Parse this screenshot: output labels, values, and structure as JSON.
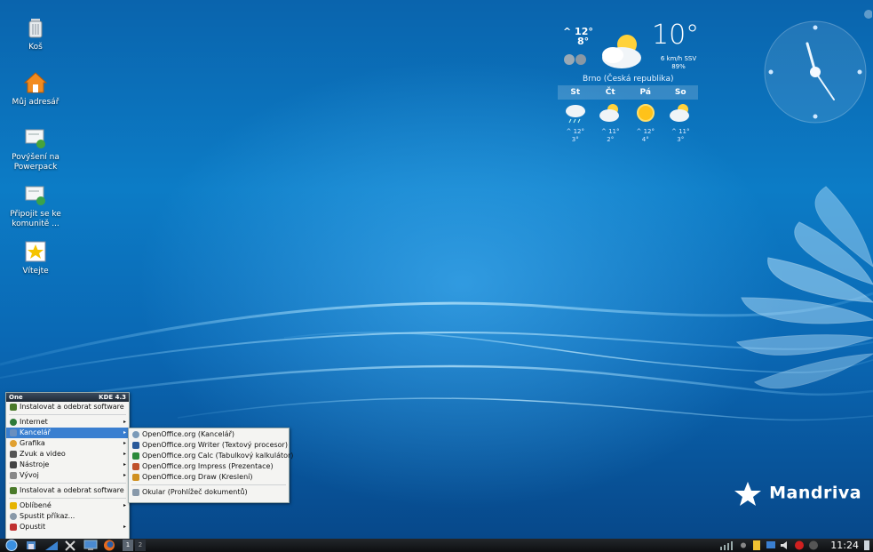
{
  "desktop_icons": [
    {
      "label": "Koš",
      "icon": "trash-icon"
    },
    {
      "label": "Můj adresář",
      "icon": "home-folder-icon"
    },
    {
      "label": "Povýšení na Powerpack",
      "icon": "upgrade-icon"
    },
    {
      "label": "Připojit se ke komunitě ...",
      "icon": "community-icon"
    },
    {
      "label": "Vítejte",
      "icon": "welcome-icon"
    }
  ],
  "weather": {
    "hi_lo_high": "^ 12°",
    "hi_lo_low": "8°",
    "current_temp": "10°",
    "wind": "6 km/h SSV",
    "humidity": "89%",
    "location": "Brno (Česká republika)",
    "days": [
      {
        "name": "St",
        "high": "^ 12°",
        "low": "3°",
        "icon": "cloud-rain-icon"
      },
      {
        "name": "Čt",
        "high": "^ 11°",
        "low": "2°",
        "icon": "partly-cloudy-icon"
      },
      {
        "name": "Pá",
        "high": "^ 12°",
        "low": "4°",
        "icon": "sun-icon"
      },
      {
        "name": "So",
        "high": "^ 11°",
        "low": "3°",
        "icon": "partly-cloudy-icon"
      }
    ]
  },
  "brand": {
    "name": "Mandriva"
  },
  "menu": {
    "header_left": "One",
    "header_right": "KDE 4.3",
    "items": [
      {
        "label": "Instalovat a odebrat software",
        "icon": "install-icon",
        "color": "#4a7a2a",
        "submenu": false
      },
      {
        "label": "Internet",
        "icon": "globe-icon",
        "color": "#2d7a3a",
        "submenu": true
      },
      {
        "label": "Kancelář",
        "icon": "office-icon",
        "color": "#6a8fbf",
        "submenu": true
      },
      {
        "label": "Grafika",
        "icon": "graphics-icon",
        "color": "#e0a030",
        "submenu": true
      },
      {
        "label": "Zvuk a video",
        "icon": "media-icon",
        "color": "#555555",
        "submenu": true
      },
      {
        "label": "Nástroje",
        "icon": "tools-icon",
        "color": "#444444",
        "submenu": true
      },
      {
        "label": "Vývoj",
        "icon": "devel-icon",
        "color": "#888888",
        "submenu": true
      },
      {
        "label": "Instalovat a odebrat software",
        "icon": "install-icon",
        "color": "#4a7a2a",
        "submenu": false
      },
      {
        "label": "Oblíbené",
        "icon": "favorites-icon",
        "color": "#e6b400",
        "submenu": true
      },
      {
        "label": "Spustit příkaz...",
        "icon": "run-icon",
        "color": "#8898a8",
        "submenu": false
      },
      {
        "label": "Opustit",
        "icon": "quit-icon",
        "color": "#c03030",
        "submenu": true
      }
    ],
    "selected_index": 2
  },
  "submenu": {
    "items": [
      {
        "label": "OpenOffice.org (Kancelář)",
        "icon": "openoffice-icon",
        "color": "#7a9ab8"
      },
      {
        "label": "OpenOffice.org Writer (Textový procesor)",
        "icon": "writer-icon",
        "color": "#2a5a9a"
      },
      {
        "label": "OpenOffice.org Calc (Tabulkový kalkulátor)",
        "icon": "calc-icon",
        "color": "#2a8a3a"
      },
      {
        "label": "OpenOffice.org Impress (Prezentace)",
        "icon": "impress-icon",
        "color": "#c0502a"
      },
      {
        "label": "OpenOffice.org Draw (Kreslení)",
        "icon": "draw-icon",
        "color": "#d09020"
      },
      {
        "label": "Okular (Prohlížeč dokumentů)",
        "icon": "okular-icon",
        "color": "#8899aa"
      }
    ]
  },
  "taskbar": {
    "launchers": [
      "kde-menu-icon",
      "file-manager-icon",
      "desktop-icon",
      "tools-icon",
      "monitor-icon",
      "firefox-icon"
    ],
    "pager": [
      "1",
      "2"
    ],
    "tray": [
      "network-icon",
      "notes-icon",
      "display-icon",
      "volume-icon",
      "update-icon",
      "info-icon"
    ],
    "time": "11:24"
  }
}
